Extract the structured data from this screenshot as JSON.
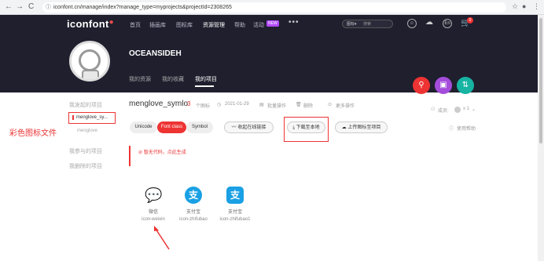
{
  "browser": {
    "back": "←",
    "forward": "→",
    "reload": "C",
    "url": "iconfont.cn/manage/index?manage_type=myprojects&projectId=2308265",
    "right_icons": [
      "☆",
      "●",
      "⋮"
    ]
  },
  "header": {
    "logo": "iconfont",
    "nav": [
      "首页",
      "插画库",
      "图标库",
      "资源管理",
      "帮助",
      "活动"
    ],
    "new_badge": "NEW",
    "more": "•••",
    "search_scope": "图标▾",
    "search_placeholder": "搜索",
    "cart_count": "0",
    "username": "OCEANSIDEH",
    "profile_tabs": [
      "我的资源",
      "我的收藏",
      "我的项目"
    ]
  },
  "sidebar": {
    "my_projects": "我发起的项目",
    "active_project": "menglove_sy...",
    "sub_project": "menglove",
    "joined": "我参与的项目",
    "deleted": "我删除的项目"
  },
  "annotation": "彩色图标文件",
  "project": {
    "name": "menglove_symlo",
    "count": "3",
    "count_unit": "个图标",
    "date": "2021-01-29",
    "batch": "批量操作",
    "delete": "删除",
    "more": "更多操作",
    "members": "成员:",
    "member_count": "x 1"
  },
  "tabs": [
    "Unicode",
    "Font class",
    "Symbol"
  ],
  "buttons": {
    "online": "收起在线链接",
    "download": "下载至本地",
    "upload": "上传图标至项目",
    "help": "使用帮助"
  },
  "error_text": "暂无代码，点此生成",
  "icons": [
    {
      "name": "微信",
      "code": "icon-weixin",
      "color": "#09bb07",
      "glyph": "●"
    },
    {
      "name": "支付宝",
      "code": "icon-zhifubao",
      "color": "#1aa0e4",
      "glyph": "支"
    },
    {
      "name": "支付宝",
      "code": "icon-zhifubao1",
      "color": "#1aa0e4",
      "glyph": "支"
    }
  ],
  "colors": {
    "accent": "#e33333",
    "header_bg": "#1f1f2e",
    "fab_purple": "#a54ddb",
    "fab_teal": "#17b3a3"
  }
}
